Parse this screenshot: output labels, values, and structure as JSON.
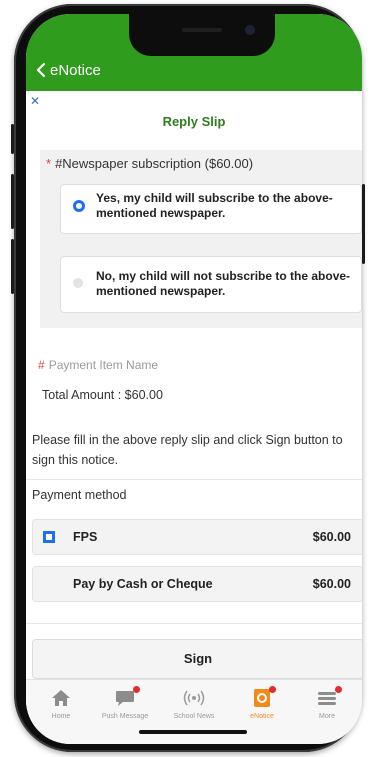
{
  "app_bar": {
    "back_label": "eNotice",
    "color": "#2f9c1e"
  },
  "reply_slip": {
    "title": "Reply Slip",
    "question_label": "#Newspaper subscription ($60.00)",
    "options": [
      {
        "text": "Yes, my child will subscribe to the above-mentioned newspaper.",
        "selected": true
      },
      {
        "text": "No, my child will not subscribe to the above-mentioned newspaper.",
        "selected": false
      }
    ]
  },
  "payment": {
    "item_name_label": "Payment Item Name",
    "total_amount": "Total Amount : $60.00",
    "instructions": "Please fill in the above reply slip and click Sign button to sign this notice.",
    "method_label": "Payment method",
    "methods": [
      {
        "name": "FPS",
        "price": "$60.00",
        "selected": true
      },
      {
        "name": "Pay by Cash or Cheque",
        "price": "$60.00",
        "selected": false
      }
    ]
  },
  "sign_button_label": "Sign",
  "tabs": [
    {
      "label": "Home",
      "icon": "home-icon",
      "badge": false
    },
    {
      "label": "Push Message",
      "icon": "message-icon",
      "badge": true
    },
    {
      "label": "School News",
      "icon": "broadcast-icon",
      "badge": false
    },
    {
      "label": "eNotice",
      "icon": "enotice-icon",
      "badge": true,
      "active": true
    },
    {
      "label": "More",
      "icon": "menu-icon",
      "badge": true
    }
  ],
  "colors": {
    "accent_green": "#2f9c1e",
    "active_tab": "#f08a18",
    "radio_blue": "#1e6ff0",
    "badge_red": "#e52b2b"
  }
}
